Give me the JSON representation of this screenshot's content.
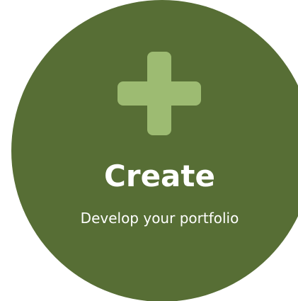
{
  "card": {
    "title": "Create",
    "subtitle": "Develop your portfolio",
    "icon": "plus-icon",
    "colors": {
      "background": "#576e35",
      "icon": "#9dbb72",
      "text": "#ffffff"
    }
  }
}
